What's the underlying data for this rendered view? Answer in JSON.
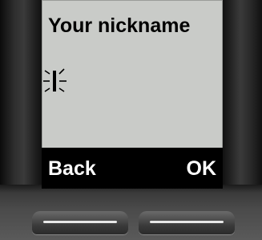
{
  "screen": {
    "title": "Your nickname",
    "softkeys": {
      "left_label": "Back",
      "right_label": "OK"
    }
  },
  "icons": {
    "cursor": "blinking-text-cursor-icon"
  },
  "colors": {
    "screen_bg": "#c9cbc8",
    "softkey_bar": "#000000",
    "softkey_text": "#ffffff",
    "device_body": "#121212"
  }
}
